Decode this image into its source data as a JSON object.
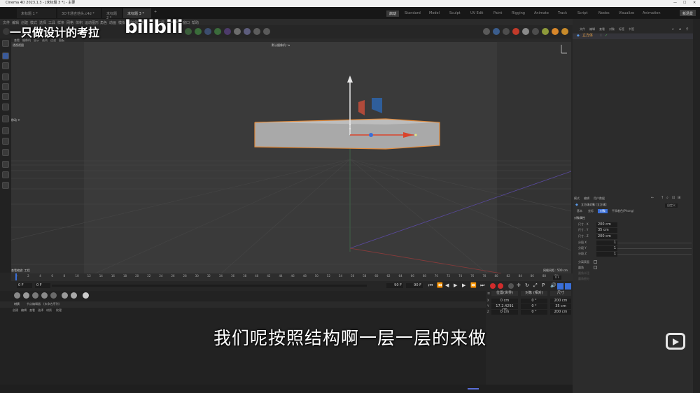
{
  "window": {
    "title": "Cinema 4D 2023.1.3 - [未标题 3 *] - 主要"
  },
  "doc_tabs": [
    {
      "label": "未标题 1 *",
      "active": false
    },
    {
      "label": "3D卡通吉他头.c4d *",
      "active": false
    },
    {
      "label": "未标题 2 *",
      "active": false
    },
    {
      "label": "未标题 3 *",
      "active": true
    }
  ],
  "layout_tabs": [
    "Standard",
    "Model",
    "Sculpt",
    "UV Edit",
    "Paint",
    "Rigging",
    "Animate",
    "Track",
    "Script",
    "Nodes",
    "Visualize",
    "Animation"
  ],
  "layout_active_badge": "启动",
  "new_scene_label": "新场景",
  "menu": [
    "文件",
    "编辑",
    "创建",
    "模式",
    "选择",
    "工具",
    "样条",
    "网格",
    "体积",
    "运动图形",
    "角色",
    "动画",
    "模拟",
    "跟踪器",
    "渲染",
    "扩展",
    "Redshift",
    "窗口",
    "帮助"
  ],
  "viewport": {
    "menu": [
      "查看",
      "摄像机",
      "显示",
      "选项",
      "过滤",
      "面板"
    ],
    "camera_label": "默认摄像机 ::▾",
    "bottom_left": "查看缩放: 工程",
    "bottom_right": "网格间距 : 500 cm",
    "side_label": "移动 ✛",
    "top_left_label": "透视视图"
  },
  "object_manager": {
    "tabs": [
      "文件",
      "编辑",
      "查看",
      "对象",
      "标签",
      "书签"
    ],
    "object_name": "立方体"
  },
  "attribute_manager": {
    "tabs": [
      "模式",
      "编辑",
      "用户数据"
    ],
    "object_title": "立方体对象 [立方体]",
    "preset": "自定义",
    "sub_tabs": [
      "基本",
      "坐标",
      "对象",
      "平滑着色(Phong)"
    ],
    "section": "对象属性",
    "props": [
      {
        "label": "尺寸 . X",
        "value": "200 cm"
      },
      {
        "label": "尺寸 . Y",
        "value": "35 cm"
      },
      {
        "label": "尺寸 . Z",
        "value": "200 cm"
      },
      {
        "label": "分段 X",
        "value": "1"
      },
      {
        "label": "分段 Y",
        "value": "1"
      },
      {
        "label": "分段 Z",
        "value": "1"
      }
    ],
    "checks": [
      "分离表面",
      "圆角"
    ],
    "dim_rows": [
      "圆角半径",
      "圆角细分"
    ]
  },
  "timeline": {
    "ticks": [
      "0",
      "2",
      "4",
      "6",
      "8",
      "10",
      "12",
      "14",
      "16",
      "18",
      "20",
      "22",
      "24",
      "26",
      "28",
      "30",
      "32",
      "34",
      "36",
      "38",
      "40",
      "42",
      "44",
      "46",
      "48",
      "50",
      "52",
      "54",
      "56",
      "58",
      "60",
      "62",
      "64",
      "66",
      "68",
      "70",
      "72",
      "74",
      "76",
      "78",
      "80",
      "82",
      "84",
      "86",
      "88",
      "90"
    ],
    "frame_left": "0 F",
    "frame_left2": "0 F",
    "frame_mid": "90 F",
    "frame_mid2": "90 F",
    "frame_right": "0 F"
  },
  "materials": {
    "tabs": [
      "材质",
      "节点编辑器",
      "(未命名序列)"
    ],
    "menu": [
      "创建",
      "编辑",
      "查看",
      "选择",
      "材质",
      "纹理"
    ]
  },
  "coordinates": {
    "headers": [
      "位置(世界)",
      "对象 (相对)",
      "尺寸"
    ],
    "rows": [
      {
        "axis": "X",
        "pos": "0 cm",
        "rot": "0 °",
        "size": "200 cm"
      },
      {
        "axis": "Y",
        "pos": "17.2.4291 cm",
        "rot": "0 °",
        "size": "35 cm"
      },
      {
        "axis": "Z",
        "pos": "0 cm",
        "rot": "0 °",
        "size": "200 cm"
      }
    ]
  },
  "overlay": {
    "watermark": "一只做设计的考拉",
    "site_logo": "bilibili",
    "subtitle": "我们呢按照结构啊一层一层的来做"
  },
  "colors": {
    "accent_blue": "#3a6fd8",
    "selection_orange": "#e08a3c",
    "axis_red": "#d9442c",
    "axis_green": "#4caf50",
    "record_red": "#d02c2c"
  }
}
